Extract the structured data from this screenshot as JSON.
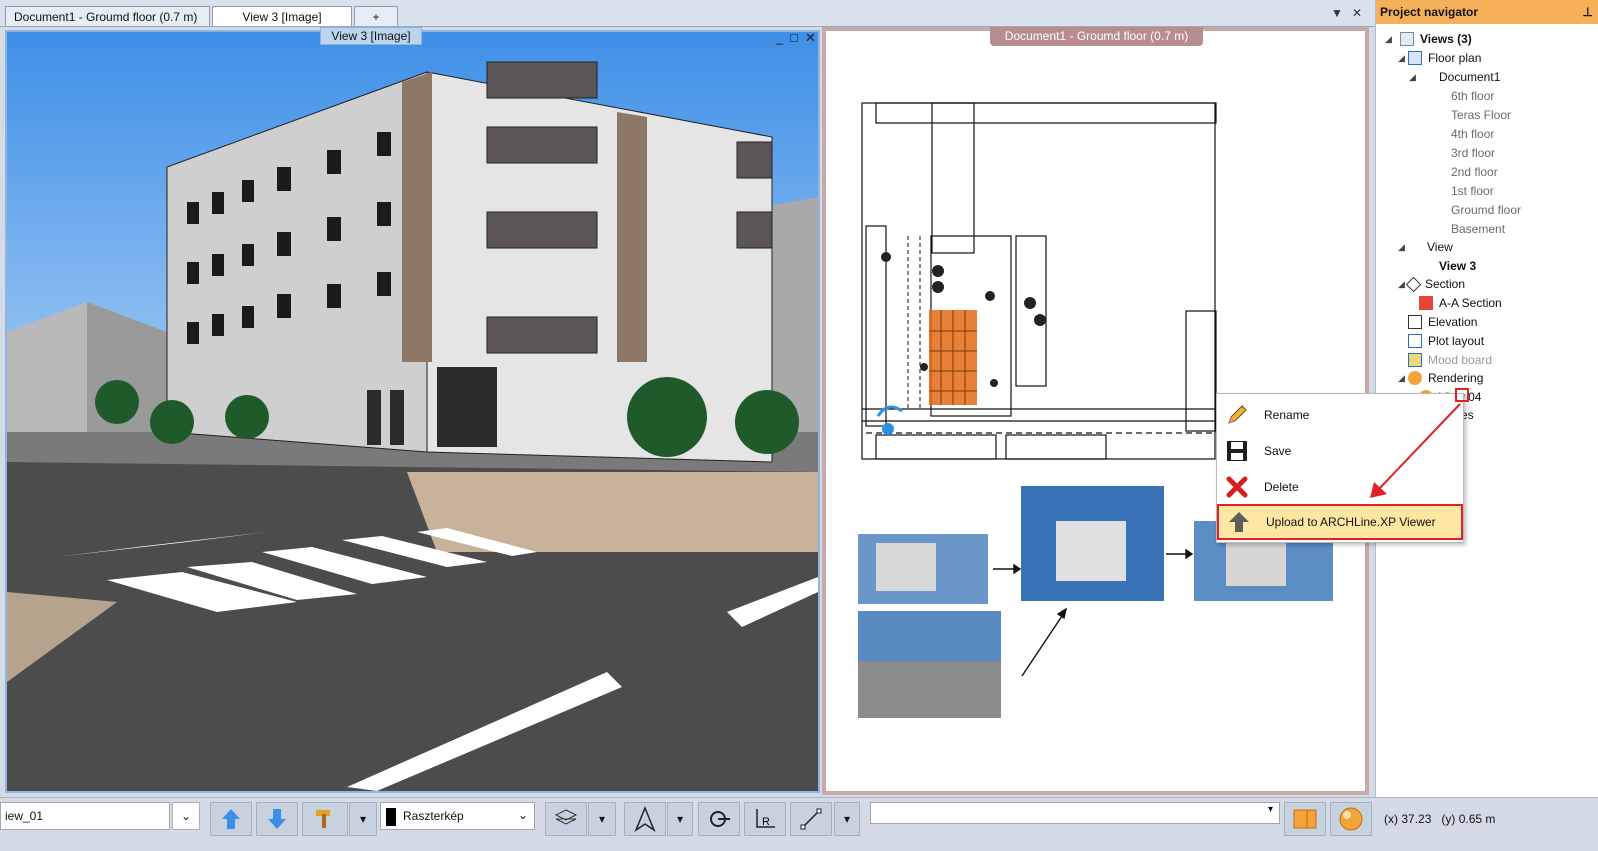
{
  "tabs": [
    {
      "label": "Document1 - Groumd floor (0.7 m)",
      "active": false
    },
    {
      "label": "View 3 [Image]",
      "active": true
    },
    {
      "label": "+",
      "active": false
    }
  ],
  "tab_controls": {
    "dropdown": "▼",
    "close": "✕"
  },
  "view3d": {
    "label": "View 3 [Image]",
    "controls": {
      "minimize": "_",
      "maximize": "□",
      "close": "✕"
    }
  },
  "plan": {
    "label": "Document1 - Groumd floor (0.7 m)"
  },
  "navigator": {
    "title": "Project navigator",
    "pin": "⊥",
    "tree": {
      "views": "Views (3)",
      "floor_plan": "Floor plan",
      "document1": "Document1",
      "floors": [
        "6th floor",
        "Teras Floor",
        "4th floor",
        "3rd floor",
        "2nd floor",
        "1st floor",
        "Groumd floor",
        "Basement"
      ],
      "view": "View",
      "view3": "View 3",
      "section": "Section",
      "aa_section": "A-A Section",
      "elevation": "Elevation",
      "plot_layout": "Plot layout",
      "mood_board": "Mood board",
      "rendering": "Rendering",
      "view04": "View 04",
      "tables": "Tables"
    }
  },
  "context_menu": {
    "items": [
      {
        "label": "Rename",
        "icon": "pencil-icon"
      },
      {
        "label": "Save",
        "icon": "floppy-icon"
      },
      {
        "label": "Delete",
        "icon": "red-x-icon"
      },
      {
        "label": "Upload to ARCHLine.XP Viewer",
        "icon": "upload-arrow-icon",
        "highlighted": true
      }
    ]
  },
  "toolbar": {
    "view_name": "iew_01",
    "layer_combo": "Raszterkép",
    "search_value": ""
  },
  "status": {
    "x_label": "(x)",
    "x_value": "37.23",
    "y_label": "(y)",
    "y_value": "0.65 m"
  },
  "colors": {
    "accent_orange": "#f7b05a",
    "highlight_red": "#e1202a",
    "highlight_fill": "#fde7a3",
    "viewport_border": "#8fb4de",
    "plan_border": "#c7a9a9"
  }
}
